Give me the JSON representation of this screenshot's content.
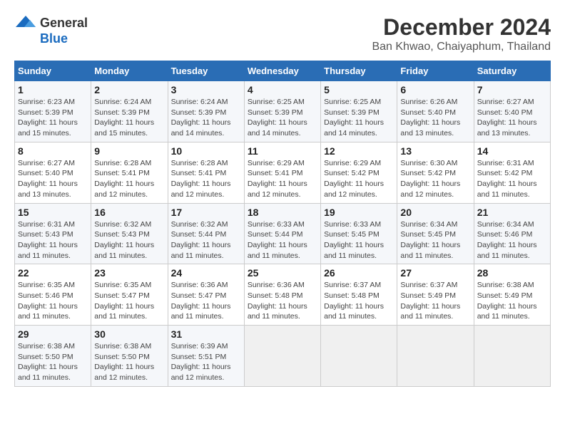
{
  "logo": {
    "general": "General",
    "blue": "Blue"
  },
  "title": {
    "month": "December 2024",
    "location": "Ban Khwao, Chaiyaphum, Thailand"
  },
  "calendar": {
    "headers": [
      "Sunday",
      "Monday",
      "Tuesday",
      "Wednesday",
      "Thursday",
      "Friday",
      "Saturday"
    ],
    "weeks": [
      [
        {
          "day": "1",
          "sunrise": "6:23 AM",
          "sunset": "5:39 PM",
          "daylight": "11 hours and 15 minutes."
        },
        {
          "day": "2",
          "sunrise": "6:24 AM",
          "sunset": "5:39 PM",
          "daylight": "11 hours and 15 minutes."
        },
        {
          "day": "3",
          "sunrise": "6:24 AM",
          "sunset": "5:39 PM",
          "daylight": "11 hours and 14 minutes."
        },
        {
          "day": "4",
          "sunrise": "6:25 AM",
          "sunset": "5:39 PM",
          "daylight": "11 hours and 14 minutes."
        },
        {
          "day": "5",
          "sunrise": "6:25 AM",
          "sunset": "5:39 PM",
          "daylight": "11 hours and 14 minutes."
        },
        {
          "day": "6",
          "sunrise": "6:26 AM",
          "sunset": "5:40 PM",
          "daylight": "11 hours and 13 minutes."
        },
        {
          "day": "7",
          "sunrise": "6:27 AM",
          "sunset": "5:40 PM",
          "daylight": "11 hours and 13 minutes."
        }
      ],
      [
        {
          "day": "8",
          "sunrise": "6:27 AM",
          "sunset": "5:40 PM",
          "daylight": "11 hours and 13 minutes."
        },
        {
          "day": "9",
          "sunrise": "6:28 AM",
          "sunset": "5:41 PM",
          "daylight": "11 hours and 12 minutes."
        },
        {
          "day": "10",
          "sunrise": "6:28 AM",
          "sunset": "5:41 PM",
          "daylight": "11 hours and 12 minutes."
        },
        {
          "day": "11",
          "sunrise": "6:29 AM",
          "sunset": "5:41 PM",
          "daylight": "11 hours and 12 minutes."
        },
        {
          "day": "12",
          "sunrise": "6:29 AM",
          "sunset": "5:42 PM",
          "daylight": "11 hours and 12 minutes."
        },
        {
          "day": "13",
          "sunrise": "6:30 AM",
          "sunset": "5:42 PM",
          "daylight": "11 hours and 12 minutes."
        },
        {
          "day": "14",
          "sunrise": "6:31 AM",
          "sunset": "5:42 PM",
          "daylight": "11 hours and 11 minutes."
        }
      ],
      [
        {
          "day": "15",
          "sunrise": "6:31 AM",
          "sunset": "5:43 PM",
          "daylight": "11 hours and 11 minutes."
        },
        {
          "day": "16",
          "sunrise": "6:32 AM",
          "sunset": "5:43 PM",
          "daylight": "11 hours and 11 minutes."
        },
        {
          "day": "17",
          "sunrise": "6:32 AM",
          "sunset": "5:44 PM",
          "daylight": "11 hours and 11 minutes."
        },
        {
          "day": "18",
          "sunrise": "6:33 AM",
          "sunset": "5:44 PM",
          "daylight": "11 hours and 11 minutes."
        },
        {
          "day": "19",
          "sunrise": "6:33 AM",
          "sunset": "5:45 PM",
          "daylight": "11 hours and 11 minutes."
        },
        {
          "day": "20",
          "sunrise": "6:34 AM",
          "sunset": "5:45 PM",
          "daylight": "11 hours and 11 minutes."
        },
        {
          "day": "21",
          "sunrise": "6:34 AM",
          "sunset": "5:46 PM",
          "daylight": "11 hours and 11 minutes."
        }
      ],
      [
        {
          "day": "22",
          "sunrise": "6:35 AM",
          "sunset": "5:46 PM",
          "daylight": "11 hours and 11 minutes."
        },
        {
          "day": "23",
          "sunrise": "6:35 AM",
          "sunset": "5:47 PM",
          "daylight": "11 hours and 11 minutes."
        },
        {
          "day": "24",
          "sunrise": "6:36 AM",
          "sunset": "5:47 PM",
          "daylight": "11 hours and 11 minutes."
        },
        {
          "day": "25",
          "sunrise": "6:36 AM",
          "sunset": "5:48 PM",
          "daylight": "11 hours and 11 minutes."
        },
        {
          "day": "26",
          "sunrise": "6:37 AM",
          "sunset": "5:48 PM",
          "daylight": "11 hours and 11 minutes."
        },
        {
          "day": "27",
          "sunrise": "6:37 AM",
          "sunset": "5:49 PM",
          "daylight": "11 hours and 11 minutes."
        },
        {
          "day": "28",
          "sunrise": "6:38 AM",
          "sunset": "5:49 PM",
          "daylight": "11 hours and 11 minutes."
        }
      ],
      [
        {
          "day": "29",
          "sunrise": "6:38 AM",
          "sunset": "5:50 PM",
          "daylight": "11 hours and 11 minutes."
        },
        {
          "day": "30",
          "sunrise": "6:38 AM",
          "sunset": "5:50 PM",
          "daylight": "11 hours and 12 minutes."
        },
        {
          "day": "31",
          "sunrise": "6:39 AM",
          "sunset": "5:51 PM",
          "daylight": "11 hours and 12 minutes."
        },
        null,
        null,
        null,
        null
      ]
    ],
    "labels": {
      "sunrise": "Sunrise:",
      "sunset": "Sunset:",
      "daylight": "Daylight:"
    }
  }
}
